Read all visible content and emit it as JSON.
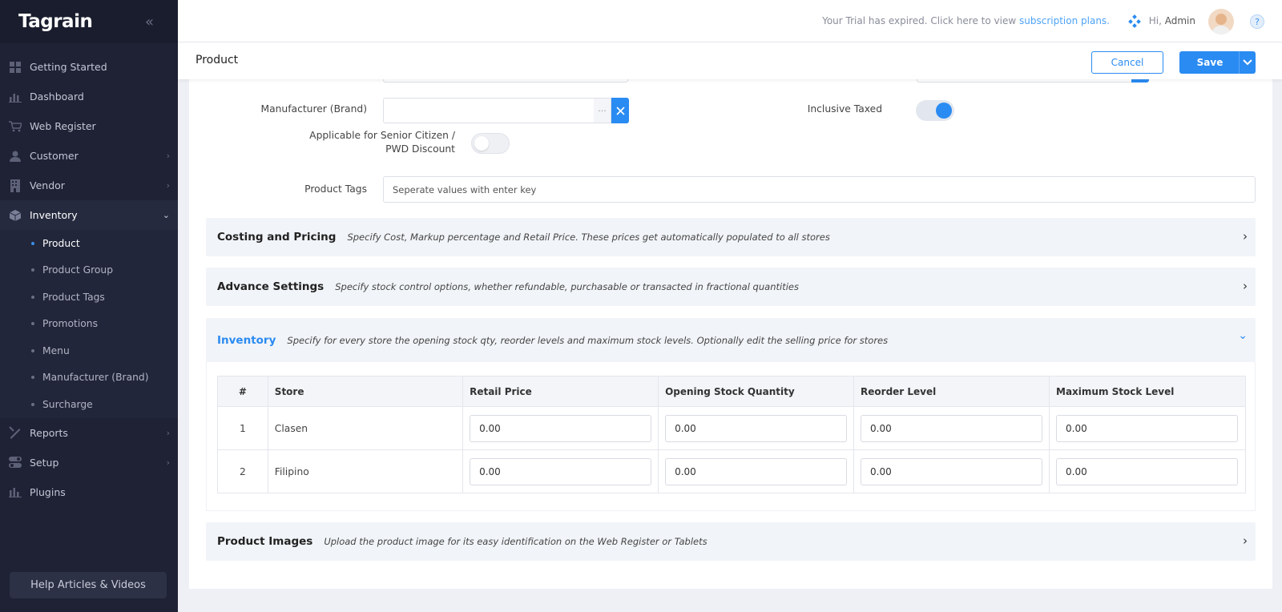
{
  "sidebar": {
    "logo": "Tagrain",
    "items": [
      {
        "label": "Getting Started",
        "icon": "grid-icon"
      },
      {
        "label": "Dashboard",
        "icon": "bar-chart-icon"
      },
      {
        "label": "Web Register",
        "icon": "cart-icon"
      },
      {
        "label": "Customer",
        "icon": "user-icon"
      },
      {
        "label": "Vendor",
        "icon": "building-icon"
      },
      {
        "label": "Inventory",
        "icon": "box-icon"
      }
    ],
    "inventory_sub": [
      "Product",
      "Product Group",
      "Product Tags",
      "Promotions",
      "Menu",
      "Manufacturer (Brand)",
      "Surcharge"
    ],
    "items_after": [
      {
        "label": "Reports",
        "icon": "pencil-ruler-icon"
      },
      {
        "label": "Setup",
        "icon": "toggle-icon"
      },
      {
        "label": "Plugins",
        "icon": "bar-chart-icon"
      }
    ],
    "help_label": "Help Articles & Videos"
  },
  "topbar": {
    "trial_text": "Your Trial has expired. Click here to view",
    "trial_link": "subscription plans.",
    "greeting": "Hi,",
    "user": "Admin",
    "help_icon": "?"
  },
  "page": {
    "title": "Product",
    "cancel_label": "Cancel",
    "save_label": "Save"
  },
  "form": {
    "manufacturer_label": "Manufacturer (Brand)",
    "inclusive_taxed_label": "Inclusive Taxed",
    "inclusive_taxed": true,
    "senior_label": "Applicable for Senior Citizen / PWD Discount",
    "senior": false,
    "tags_label": "Product Tags",
    "tags_placeholder": "Seperate values with enter key"
  },
  "sections": {
    "costing": {
      "title": "Costing and Pricing",
      "desc": "Specify Cost, Markup percentage and Retail Price. These prices get automatically populated to all stores"
    },
    "advance": {
      "title": "Advance Settings",
      "desc": "Specify stock control options, whether refundable, purchasable or transacted in fractional quantities"
    },
    "inventory": {
      "title": "Inventory",
      "desc": "Specify for every store the opening stock qty, reorder levels and maximum stock levels. Optionally edit the selling price for stores"
    },
    "images": {
      "title": "Product Images",
      "desc": "Upload the product image for its easy identification on the Web Register or Tablets"
    }
  },
  "inventory_table": {
    "headers": [
      "#",
      "Store",
      "Retail Price",
      "Opening Stock Quantity",
      "Reorder Level",
      "Maximum Stock Level"
    ],
    "rows": [
      {
        "num": "1",
        "store": "Clasen",
        "retail": "0.00",
        "opening": "0.00",
        "reorder": "0.00",
        "max": "0.00"
      },
      {
        "num": "2",
        "store": "Filipino",
        "retail": "0.00",
        "opening": "0.00",
        "reorder": "0.00",
        "max": "0.00"
      }
    ]
  },
  "colors": {
    "accent": "#2a8bf2",
    "sidebar": "#1f2235"
  }
}
